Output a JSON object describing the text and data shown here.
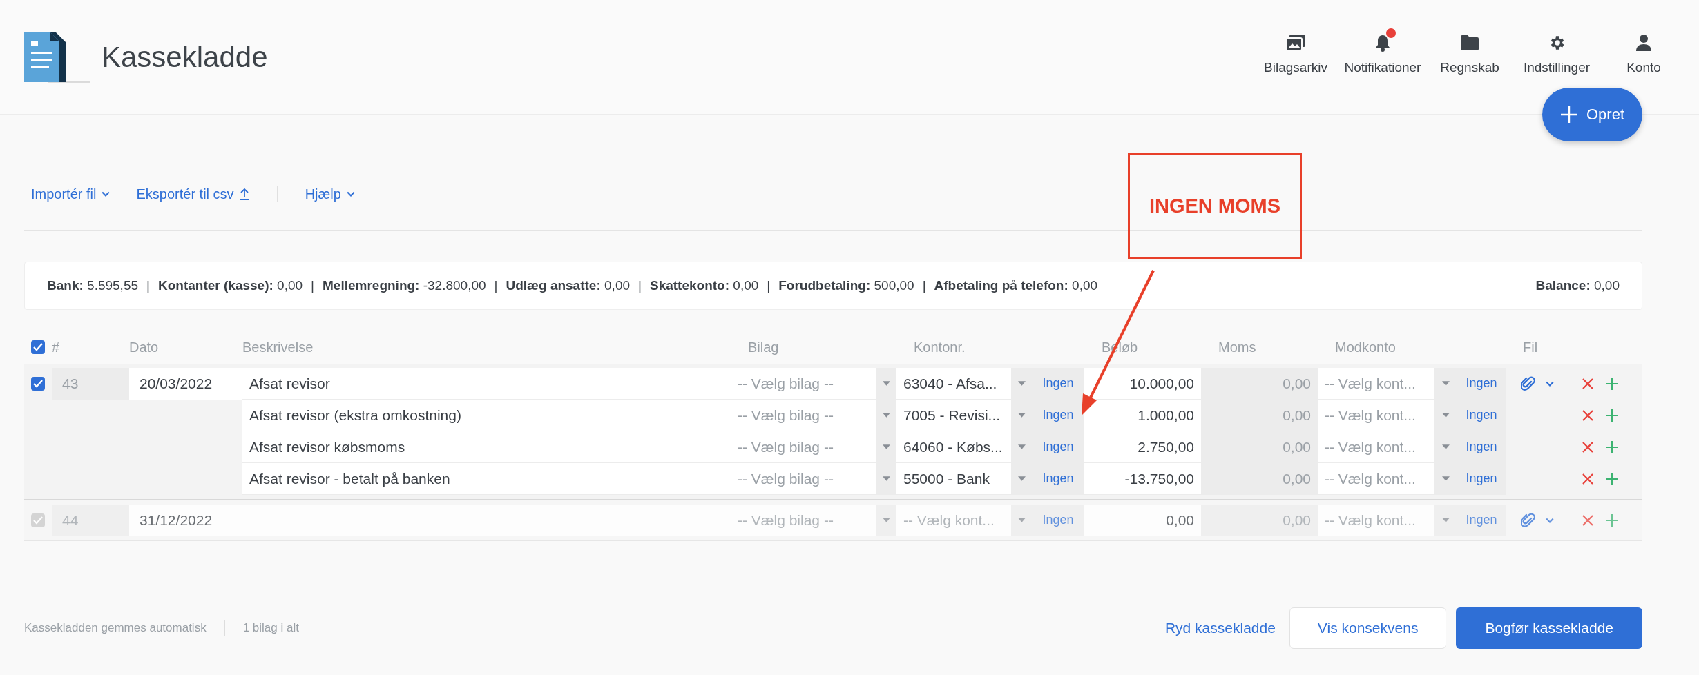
{
  "header": {
    "title": "Kassekladde",
    "nav": [
      {
        "label": "Bilagsarkiv",
        "kind": "images",
        "badge": false
      },
      {
        "label": "Notifikationer",
        "kind": "bell",
        "badge": true
      },
      {
        "label": "Regnskab",
        "kind": "folder",
        "badge": false
      },
      {
        "label": "Indstillinger",
        "kind": "gear",
        "badge": false
      },
      {
        "label": "Konto",
        "kind": "person",
        "badge": false
      }
    ],
    "create_button": "Opret"
  },
  "toolbar": {
    "groups": [
      [
        {
          "label": "Importér fil",
          "kind": "menu"
        },
        {
          "label": "Eksportér til csv",
          "kind": "export"
        }
      ],
      [
        {
          "label": "Hjælp",
          "kind": "menu"
        }
      ]
    ]
  },
  "summary": {
    "separator": "|",
    "items": [
      {
        "label": "Bank:",
        "value": "5.595,55"
      },
      {
        "label": "Kontanter (kasse):",
        "value": "0,00"
      },
      {
        "label": "Mellemregning:",
        "value": "-32.800,00"
      },
      {
        "label": "Udlæg ansatte:",
        "value": "0,00"
      },
      {
        "label": "Skattekonto:",
        "value": "0,00"
      },
      {
        "label": "Forudbetaling:",
        "value": "500,00"
      },
      {
        "label": "Afbetaling på telefon:",
        "value": "0,00"
      }
    ],
    "balance": {
      "label": "Balance:",
      "value": "0,00"
    }
  },
  "table": {
    "header_checked": true,
    "columns": [
      "#",
      "Dato",
      "Beskrivelse",
      "Bilag",
      "Kontonr.",
      "Beløb",
      "Moms",
      "Modkonto",
      "Fil"
    ],
    "entries": [
      {
        "checked": true,
        "disabled": false,
        "number": "43",
        "date": "20/03/2022",
        "lines": [
          {
            "description": "Afsat revisor",
            "voucher_placeholder": "-- Vælg bilag --",
            "account": "63040 - Afsa...",
            "vat_code": "Ingen",
            "amount": "10.000,00",
            "vat_amount": "0,00",
            "counter_account_placeholder": "-- Vælg kont...",
            "counter_vat_code": "Ingen",
            "attachment": true
          },
          {
            "description": "Afsat revisor (ekstra omkostning)",
            "voucher_placeholder": "-- Vælg bilag --",
            "account": "7005 - Revisi...",
            "vat_code": "Ingen",
            "amount": "1.000,00",
            "vat_amount": "0,00",
            "counter_account_placeholder": "-- Vælg kont...",
            "counter_vat_code": "Ingen"
          },
          {
            "description": "Afsat revisor købsmoms",
            "voucher_placeholder": "-- Vælg bilag --",
            "account": "64060 - Købs...",
            "vat_code": "Ingen",
            "amount": "2.750,00",
            "vat_amount": "0,00",
            "counter_account_placeholder": "-- Vælg kont...",
            "counter_vat_code": "Ingen"
          },
          {
            "description": "Afsat revisor - betalt på banken",
            "voucher_placeholder": "-- Vælg bilag --",
            "account": "55000 - Bank",
            "vat_code": "Ingen",
            "amount": "-13.750,00",
            "vat_amount": "0,00",
            "counter_account_placeholder": "-- Vælg kont...",
            "counter_vat_code": "Ingen"
          }
        ]
      },
      {
        "checked": true,
        "disabled": true,
        "number": "44",
        "date": "31/12/2022",
        "lines": [
          {
            "voucher_placeholder": "-- Vælg bilag --",
            "account_placeholder": "-- Vælg kont...",
            "vat_code": "Ingen",
            "amount": "0,00",
            "vat_amount": "0,00",
            "counter_account_placeholder": "-- Vælg kont...",
            "counter_vat_code": "Ingen",
            "attachment": true
          }
        ]
      }
    ]
  },
  "footer": {
    "status": "Kassekladden gemmes automatisk",
    "count": "1 bilag i alt",
    "clear_link": "Ryd kassekladde",
    "preview_button": "Vis konsekvens",
    "post_button": "Bogfør kassekladde"
  },
  "annotation": {
    "text": "INGEN MOMS"
  }
}
